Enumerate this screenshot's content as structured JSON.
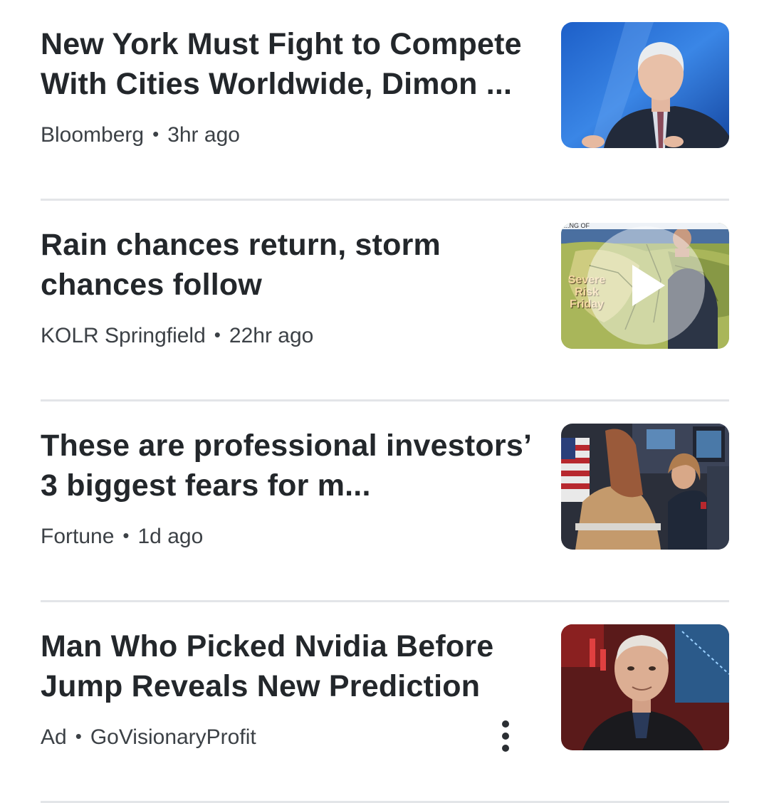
{
  "articles": [
    {
      "headline": "New York Must Fight to Compete With Cities Worldwide, Dimon ...",
      "source": "Bloomberg",
      "time": "3hr ago",
      "thumbnail_icon": "person-portrait-image"
    },
    {
      "headline": "Rain chances return, storm chances follow",
      "source": "KOLR Springfield",
      "time": "22hr ago",
      "thumbnail_icon": "weather-map-video",
      "thumbnail_caption": "Severe Risk Friday",
      "thumbnail_header": "...NG OF",
      "is_video": true
    },
    {
      "headline": "These are professional investors’ 3 biggest fears for m...",
      "source": "Fortune",
      "time": "1d ago",
      "thumbnail_icon": "trading-floor-image"
    },
    {
      "headline": "Man Who Picked Nvidia Before Jump Reveals New Prediction",
      "source": "Ad",
      "time": "GoVisionaryProfit",
      "thumbnail_icon": "person-portrait-image",
      "has_more_menu": true
    }
  ],
  "meta_separator": "•",
  "colors": {
    "headline": "#23272b",
    "meta": "#3c4146",
    "divider": "#e3e5e8"
  }
}
